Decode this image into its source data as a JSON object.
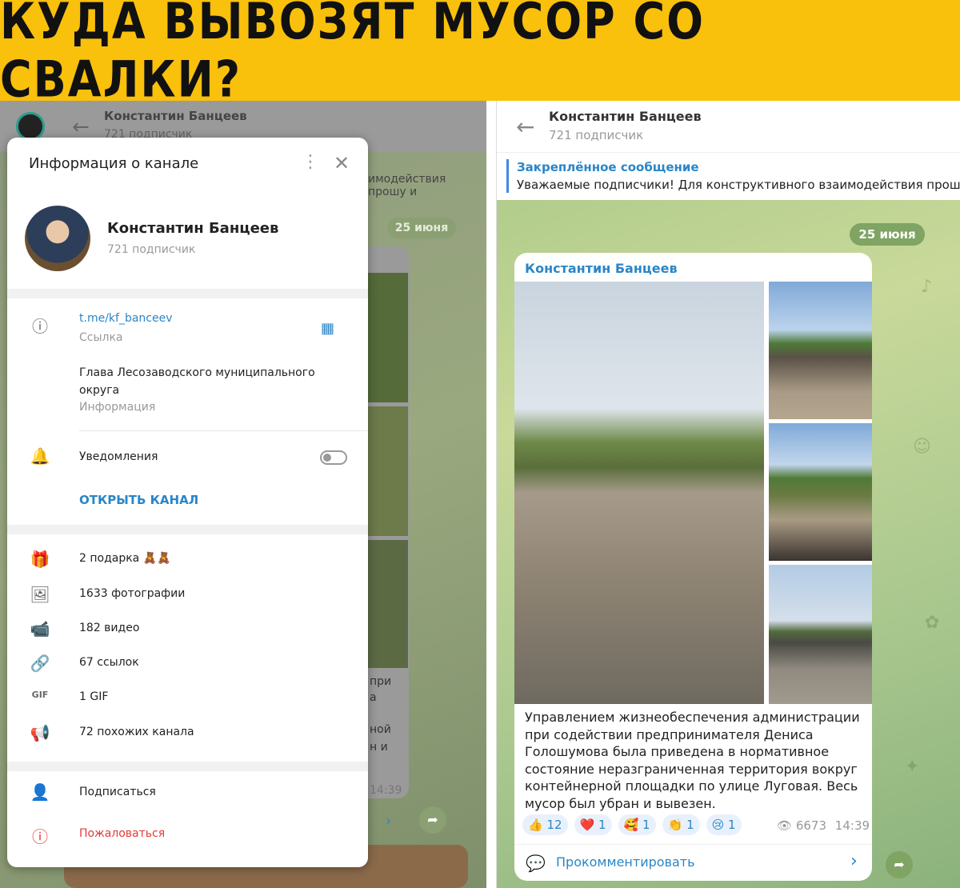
{
  "banner": {
    "title": "КУДА ВЫВОЗЯТ МУСОР СО СВАЛКИ?"
  },
  "left": {
    "header_title": "Константин Банцеев",
    "header_subtitle": "721 подписчик",
    "pinned_fragment": "имодействия прошу и",
    "date": "25 июня",
    "text_fragments": [
      "при",
      "а",
      "ной",
      "н и"
    ],
    "time": "14:39",
    "popup": {
      "title": "Информация о канале",
      "channel_name": "Константин Банцеев",
      "subscribers": "721 подписчик",
      "link": "t.me/kf_banceev",
      "link_label": "Ссылка",
      "description": "Глава Лесозаводского муниципального округа",
      "description_label": "Информация",
      "notifications_label": "Уведомления",
      "open_channel": "ОТКРЫТЬ КАНАЛ",
      "media": [
        {
          "icon": "gift-icon",
          "glyph": "🎁",
          "label": "2 подарка 🧸🧸"
        },
        {
          "icon": "photo-icon",
          "glyph": "🖼",
          "label": "1633 фотографии"
        },
        {
          "icon": "video-icon",
          "glyph": "📹",
          "label": "182 видео"
        },
        {
          "icon": "link-icon",
          "glyph": "🔗",
          "label": "67 ссылок"
        },
        {
          "icon": "gif-icon",
          "glyph": "GIF",
          "label": "1 GIF"
        },
        {
          "icon": "megaphone-icon",
          "glyph": "📢",
          "label": "72 похожих канала"
        }
      ],
      "subscribe": "Подписаться",
      "report": "Пожаловаться"
    }
  },
  "right": {
    "header_title": "Константин Банцеев",
    "header_subtitle": "721 подписчик",
    "pinned_title": "Закреплённое сообщение",
    "pinned_text": "Уважаемые подписчики! Для конструктивного взаимодействия прошу в",
    "date": "25 июня",
    "author": "Константин Банцеев",
    "post_text": "Управлением жизнеобеспечения администрации при содействии предпринимателя Дениса Голошумова была приведена в нормативное состояние неразграниченная территория вокруг контейнерной площадки по улице Луговая. Весь мусор был убран и вывезен.",
    "reactions": [
      {
        "emoji": "👍",
        "count": "12"
      },
      {
        "emoji": "❤️",
        "count": "1"
      },
      {
        "emoji": "🥰",
        "count": "1"
      },
      {
        "emoji": "👏",
        "count": "1"
      },
      {
        "emoji": "😢",
        "count": "1"
      }
    ],
    "views": "6673",
    "time": "14:39",
    "comment": "Прокомментировать"
  },
  "colors": {
    "banner": "#f9c00c",
    "link": "#2a86c7",
    "danger": "#e53935"
  }
}
